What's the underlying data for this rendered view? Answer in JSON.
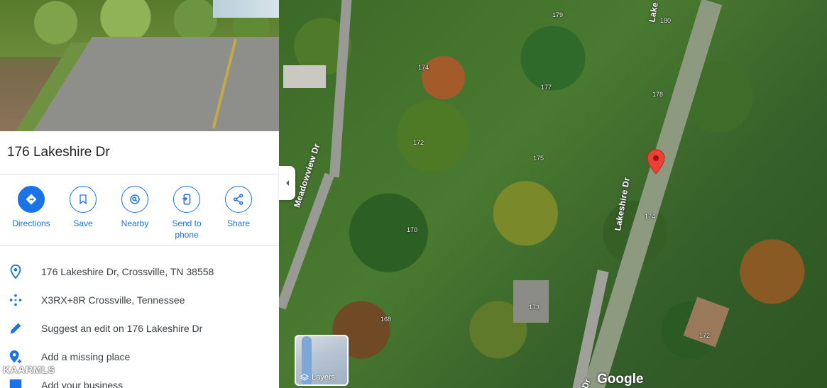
{
  "place": {
    "title": "176 Lakeshire Dr"
  },
  "actions": [
    {
      "label": "Directions",
      "icon": "directions-icon"
    },
    {
      "label": "Save",
      "icon": "bookmark-icon"
    },
    {
      "label": "Nearby",
      "icon": "nearby-icon"
    },
    {
      "label": "Send to phone",
      "icon": "send-to-phone-icon"
    },
    {
      "label": "Share",
      "icon": "share-icon"
    }
  ],
  "info_rows": [
    {
      "text": "176 Lakeshire Dr, Crossville, TN 38558",
      "icon": "location-pin-icon"
    },
    {
      "text": "X3RX+8R Crossville, Tennessee",
      "icon": "plus-code-icon"
    },
    {
      "text": "Suggest an edit on 176 Lakeshire Dr",
      "icon": "pencil-icon"
    },
    {
      "text": "Add a missing place",
      "icon": "add-place-icon"
    },
    {
      "text": "Add your business",
      "icon": "business-icon"
    }
  ],
  "watermark": "KAARMLS",
  "map": {
    "streets": [
      "Meadowview Dr",
      "Lakeshire Dr",
      "Lake",
      "Dr"
    ],
    "parcels": [
      "179",
      "180",
      "174",
      "177",
      "178",
      "172",
      "175",
      "170",
      "174",
      "173",
      "168",
      "172"
    ],
    "layers_label": "Layers",
    "logo": "Google"
  },
  "colors": {
    "accent": "#1a73e8",
    "pin": "#ea4335"
  }
}
